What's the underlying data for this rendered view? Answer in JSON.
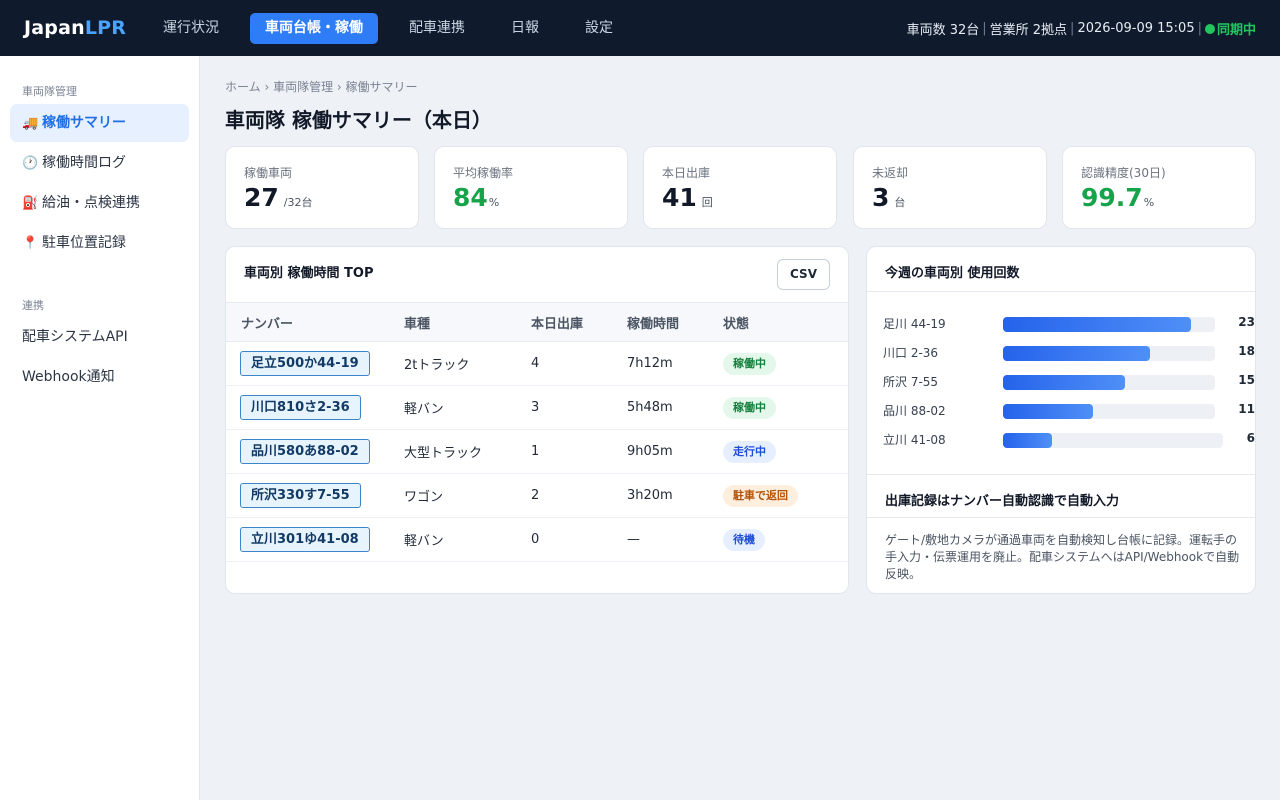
{
  "brand": {
    "name_a": "Japan",
    "name_b": "LPR"
  },
  "nav": [
    {
      "label": "運行状況",
      "active": false
    },
    {
      "label": "車両台帳・稼働",
      "active": true
    },
    {
      "label": "配車連携",
      "active": false
    },
    {
      "label": "日報",
      "active": false
    },
    {
      "label": "設定",
      "active": false
    }
  ],
  "status_bar": {
    "vehicles": "車両数 32台",
    "offices": "営業所 2拠点",
    "datetime": "2026-09-09 15:05",
    "sync": "同期中",
    "sync_color": "#22c55e"
  },
  "sidebar": {
    "section1": "車両隊管理",
    "items": [
      {
        "icon": "🚚",
        "label": "稼働サマリー",
        "active": true
      },
      {
        "icon": "🕐",
        "label": "稼働時間ログ",
        "active": false
      },
      {
        "icon": "⛽",
        "label": "給油・点検連携",
        "active": false
      },
      {
        "icon": "📍",
        "label": "駐車位置記録",
        "active": false
      }
    ],
    "section2": "連携",
    "items2": [
      {
        "label": "配車システムAPI"
      },
      {
        "label": "Webhook通知"
      }
    ]
  },
  "breadcrumb": "ホーム › 車両隊管理 › 稼働サマリー",
  "page_title": "車両隊 稼働サマリー（本日）",
  "kpis": [
    {
      "label": "稼働車両",
      "value": "27",
      "unit": "/32台",
      "accent": false
    },
    {
      "label": "平均稼働率",
      "value": "84",
      "unit": "%",
      "accent": true
    },
    {
      "label": "本日出庫",
      "value": "41",
      "unit": "回",
      "accent": false
    },
    {
      "label": "未返却",
      "value": "3",
      "unit": "台",
      "accent": false
    },
    {
      "label": "認識精度(30日)",
      "value": "99.7",
      "unit": "%",
      "accent": true
    }
  ],
  "table_card": {
    "title": "車両別 稼働時間 TOP",
    "csv_label": "CSV",
    "headers": [
      "ナンバー",
      "車種",
      "本日出庫",
      "稼働時間",
      "状態"
    ],
    "rows": [
      {
        "plate": "足立500か44-19",
        "type": "2tトラック",
        "trips": "4",
        "hours": "7h12m",
        "status": "稼働中",
        "status_kind": "green"
      },
      {
        "plate": "川口810さ2-36",
        "type": "軽バン",
        "trips": "3",
        "hours": "5h48m",
        "status": "稼働中",
        "status_kind": "green"
      },
      {
        "plate": "品川580あ88-02",
        "type": "大型トラック",
        "trips": "1",
        "hours": "9h05m",
        "status": "走行中",
        "status_kind": "blue"
      },
      {
        "plate": "所沢330す7-55",
        "type": "ワゴン",
        "trips": "2",
        "hours": "3h20m",
        "status": "駐車で返回",
        "status_kind": "orange"
      },
      {
        "plate": "立川301ゆ41-08",
        "type": "軽バン",
        "trips": "0",
        "hours": "—",
        "status": "待機",
        "status_kind": "blue"
      }
    ]
  },
  "usage_card": {
    "title": "今週の車両別 使用回数",
    "chart_data": {
      "type": "bar",
      "categories": [
        "足川 44-19",
        "川口 2-36",
        "所沢 7-55",
        "品川 88-02",
        "立川 41-08"
      ],
      "values": [
        23,
        18,
        15,
        11,
        6
      ],
      "xlim": [
        0,
        26
      ]
    },
    "info_title": "出庫記録はナンバー自動認識で自動入力",
    "info_text": "ゲート/敷地カメラが通過車両を自動検知し台帳に記録。運転手の手入力・伝票運用を廃止。配車システムへはAPI/Webhookで自動反映。"
  }
}
